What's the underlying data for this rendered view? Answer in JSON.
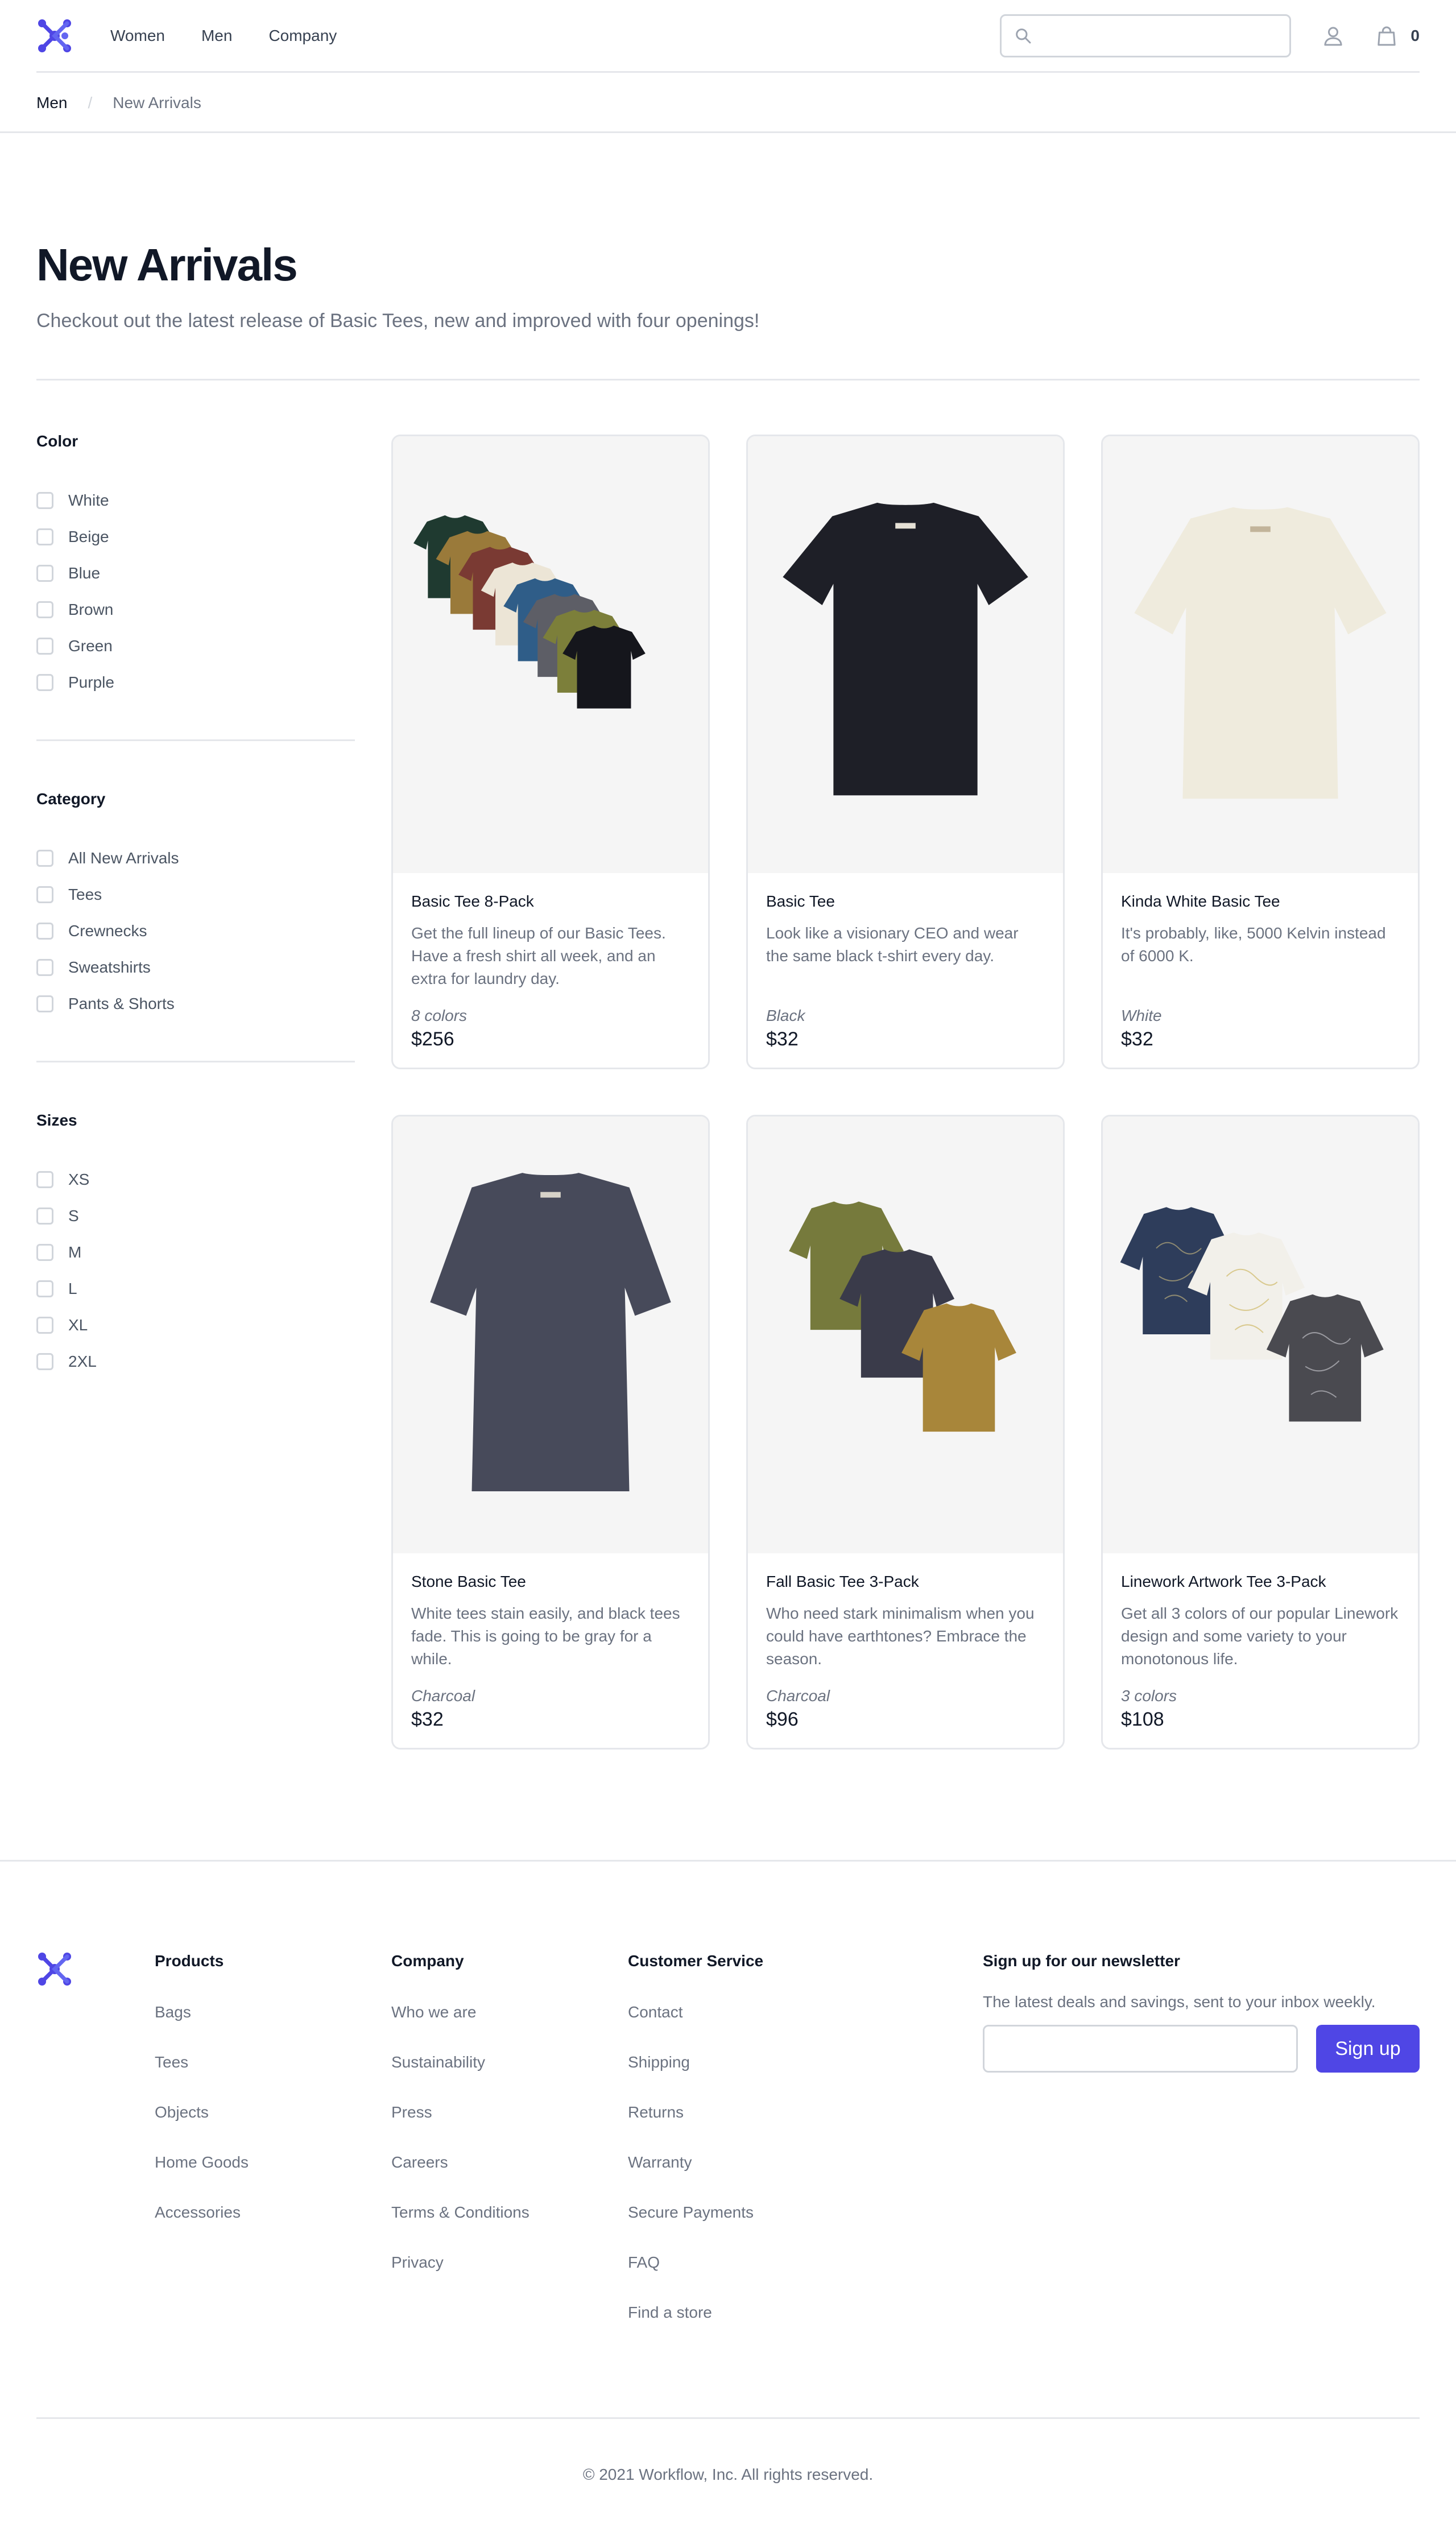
{
  "brand": {
    "logo_icon": "workflow-logo-icon",
    "accent_color": "#4f46e5"
  },
  "header": {
    "nav": [
      {
        "label": "Women"
      },
      {
        "label": "Men"
      },
      {
        "label": "Company"
      }
    ],
    "search_value": "",
    "search_icon": "search-icon",
    "account_icon": "user-icon",
    "cart_icon": "shopping-bag-icon",
    "cart_count": "0"
  },
  "breadcrumb": {
    "items": [
      {
        "label": "Men"
      },
      {
        "label": "New Arrivals"
      }
    ],
    "separator": "/"
  },
  "page": {
    "title": "New Arrivals",
    "subtitle": "Checkout out the latest release of Basic Tees, new and improved with four openings!"
  },
  "filters": [
    {
      "title": "Color",
      "options": [
        "White",
        "Beige",
        "Blue",
        "Brown",
        "Green",
        "Purple"
      ]
    },
    {
      "title": "Category",
      "options": [
        "All New Arrivals",
        "Tees",
        "Crewnecks",
        "Sweatshirts",
        "Pants & Shorts"
      ]
    },
    {
      "title": "Sizes",
      "options": [
        "XS",
        "S",
        "M",
        "L",
        "XL",
        "2XL"
      ]
    }
  ],
  "products": [
    {
      "name": "Basic Tee 8-Pack",
      "description": "Get the full lineup of our Basic Tees. Have a fresh shirt all week, and an extra for laundry day.",
      "options": "8 colors",
      "price": "$256"
    },
    {
      "name": "Basic Tee",
      "description": "Look like a visionary CEO and wear the same black t-shirt every day.",
      "options": "Black",
      "price": "$32"
    },
    {
      "name": "Kinda White Basic Tee",
      "description": "It's probably, like, 5000 Kelvin instead of 6000 K.",
      "options": "White",
      "price": "$32"
    },
    {
      "name": "Stone Basic Tee",
      "description": "White tees stain easily, and black tees fade. This is going to be gray for a while.",
      "options": "Charcoal",
      "price": "$32"
    },
    {
      "name": "Fall Basic Tee 3-Pack",
      "description": "Who need stark minimalism when you could have earthtones? Embrace the season.",
      "options": "Charcoal",
      "price": "$96"
    },
    {
      "name": "Linework Artwork Tee 3-Pack",
      "description": "Get all 3 colors of our popular Linework design and some variety to your monotonous life.",
      "options": "3 colors",
      "price": "$108"
    }
  ],
  "footer": {
    "columns": [
      {
        "title": "Products",
        "links": [
          "Bags",
          "Tees",
          "Objects",
          "Home Goods",
          "Accessories"
        ]
      },
      {
        "title": "Company",
        "links": [
          "Who we are",
          "Sustainability",
          "Press",
          "Careers",
          "Terms & Conditions",
          "Privacy"
        ]
      },
      {
        "title": "Customer Service",
        "links": [
          "Contact",
          "Shipping",
          "Returns",
          "Warranty",
          "Secure Payments",
          "FAQ",
          "Find a store"
        ]
      }
    ],
    "newsletter": {
      "title": "Sign up for our newsletter",
      "text": "The latest deals and savings, sent to your inbox weekly.",
      "email_value": "",
      "button_label": "Sign up"
    },
    "copyright": "© 2021 Workflow, Inc. All rights reserved."
  }
}
